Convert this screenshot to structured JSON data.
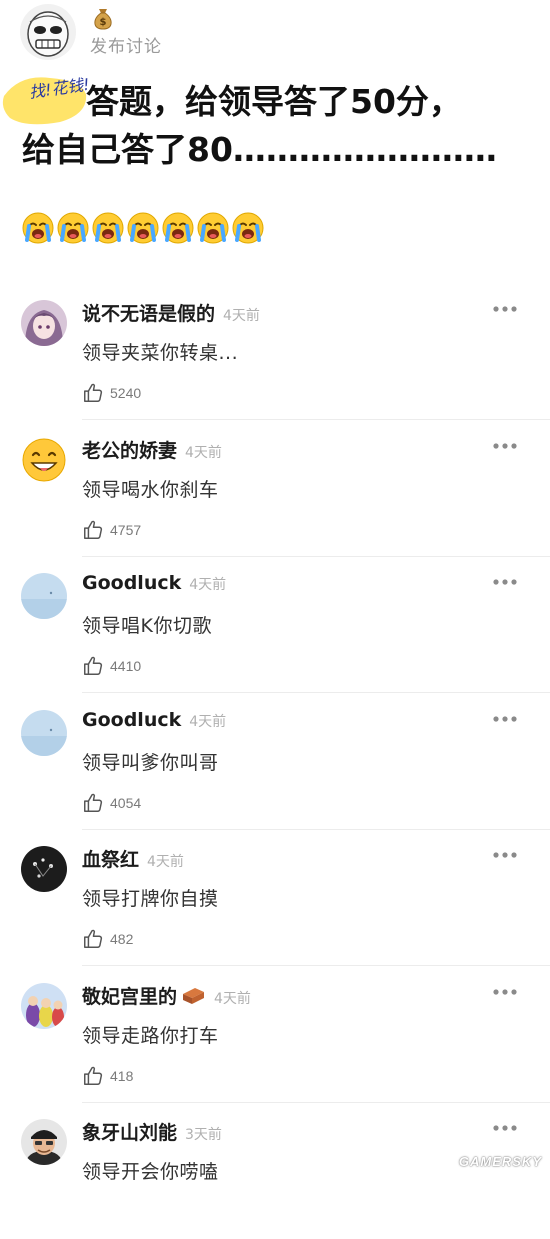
{
  "post": {
    "action_label": "发布讨论",
    "badge_icon": "money-bag-icon",
    "doodle_text": "找!花钱!",
    "title_line1": "答题，给领导答了50分，",
    "title_line2": "给自己答了80……………………",
    "emoji_icon": "loudly-crying-face-icon",
    "emoji_count": 7
  },
  "comments": [
    {
      "user": "说不无语是假的",
      "time": "4天前",
      "text": "领导夹菜你转桌...",
      "likes": "5240",
      "avatar": "anime-girl-avatar"
    },
    {
      "user": "老公的娇妻",
      "time": "4天前",
      "text": "领导喝水你刹车",
      "likes": "4757",
      "avatar": "grinning-emoji-avatar"
    },
    {
      "user": "Goodluck",
      "time": "4天前",
      "text": "领导唱K你切歌",
      "likes": "4410",
      "avatar": "sky-avatar"
    },
    {
      "user": "Goodluck",
      "time": "4天前",
      "text": "领导叫爹你叫哥",
      "likes": "4054",
      "avatar": "sky-avatar"
    },
    {
      "user": "血祭红",
      "time": "4天前",
      "text": "领导打牌你自摸",
      "likes": "482",
      "avatar": "dark-photo-avatar"
    },
    {
      "user": "敬妃宫里的",
      "time": "4天前",
      "text": "领导走路你打车",
      "likes": "418",
      "avatar": "teletubbies-avatar",
      "badge": "brick-icon"
    },
    {
      "user": "象牙山刘能",
      "time": "3天前",
      "text": "领导开会你唠嗑",
      "likes": "",
      "avatar": "man-cap-avatar"
    }
  ],
  "icons": {
    "more": "more-dots-icon",
    "like": "thumbs-up-icon"
  },
  "watermark": "GAMERSKY"
}
